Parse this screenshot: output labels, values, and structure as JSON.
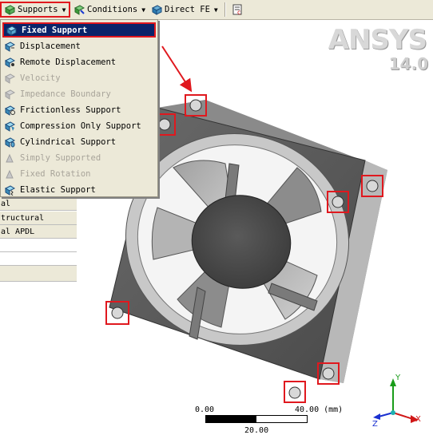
{
  "toolbar": {
    "items": [
      {
        "label": "Supports"
      },
      {
        "label": "Conditions"
      },
      {
        "label": "Direct FE"
      }
    ]
  },
  "menu": {
    "items": [
      {
        "label": "Fixed Support",
        "state": "selected"
      },
      {
        "label": "Displacement",
        "state": "enabled"
      },
      {
        "label": "Remote Displacement",
        "state": "enabled"
      },
      {
        "label": "Velocity",
        "state": "disabled"
      },
      {
        "label": "Impedance Boundary",
        "state": "disabled"
      },
      {
        "label": "Frictionless Support",
        "state": "enabled"
      },
      {
        "label": "Compression Only Support",
        "state": "enabled"
      },
      {
        "label": "Cylindrical Support",
        "state": "enabled"
      },
      {
        "label": "Simply Supported",
        "state": "disabled"
      },
      {
        "label": "Fixed Rotation",
        "state": "disabled"
      },
      {
        "label": "Elastic Support",
        "state": "enabled"
      }
    ]
  },
  "left_panel": {
    "rows": [
      "al",
      "tructural",
      "al APDL",
      "",
      ""
    ]
  },
  "logo": {
    "brand": "ANSYS",
    "version": "14.0"
  },
  "scale": {
    "start": "0.00",
    "end": "40.00 (mm)",
    "mid": "20.00"
  },
  "triad": {
    "x": "X",
    "y": "Y",
    "z": "Z"
  },
  "colors": {
    "highlight_red": "#e0181e",
    "menu_selected": "#0a246a",
    "menu_bg": "#ece9d8"
  }
}
